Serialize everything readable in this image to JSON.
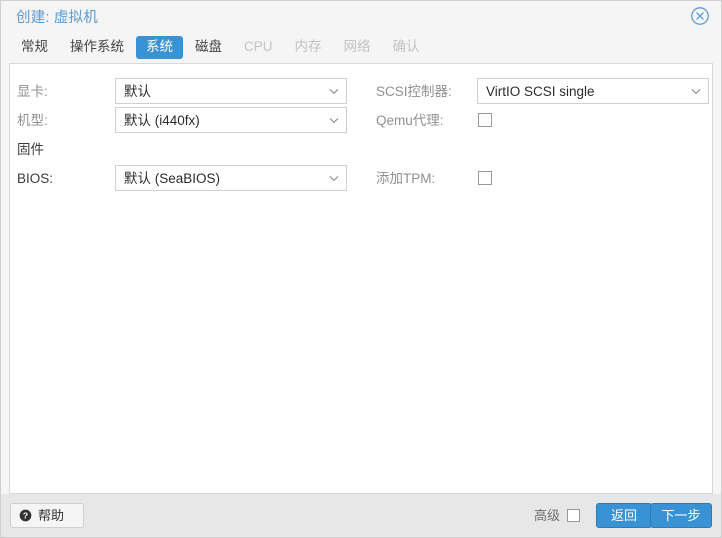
{
  "window": {
    "title": "创建: 虚拟机",
    "close_icon": "close-circle-icon"
  },
  "tabs": [
    {
      "label": "常规",
      "state": "enabled"
    },
    {
      "label": "操作系统",
      "state": "enabled"
    },
    {
      "label": "系统",
      "state": "active"
    },
    {
      "label": "磁盘",
      "state": "enabled"
    },
    {
      "label": "CPU",
      "state": "disabled"
    },
    {
      "label": "内存",
      "state": "disabled"
    },
    {
      "label": "网络",
      "state": "disabled"
    },
    {
      "label": "确认",
      "state": "disabled"
    }
  ],
  "form": {
    "left": {
      "graphic_card": {
        "label": "显卡:",
        "value": "默认"
      },
      "machine": {
        "label": "机型:",
        "value": "默认 (i440fx)"
      },
      "firmware_section": {
        "label": "固件"
      },
      "bios": {
        "label": "BIOS:",
        "value": "默认 (SeaBIOS)"
      }
    },
    "right": {
      "scsi_controller": {
        "label": "SCSI控制器:",
        "value": "VirtIO SCSI single"
      },
      "qemu_agent": {
        "label": "Qemu代理:",
        "checked": false
      },
      "add_tpm": {
        "label": "添加TPM:",
        "checked": false
      }
    }
  },
  "footer": {
    "help_label": "帮助",
    "help_icon": "question-circle-icon",
    "advanced_label": "高级",
    "advanced_checked": false,
    "back_label": "返回",
    "next_label": "下一步"
  },
  "colors": {
    "accent": "#3892d4",
    "title": "#5a9bd5",
    "header_bg": "#f5f5f5",
    "footer_bg": "#e7e7e7",
    "content_bg": "#ffffff",
    "label_gray": "#909090",
    "label_dark": "#3b3b3b",
    "disabled_tab": "#c3c3c3"
  }
}
